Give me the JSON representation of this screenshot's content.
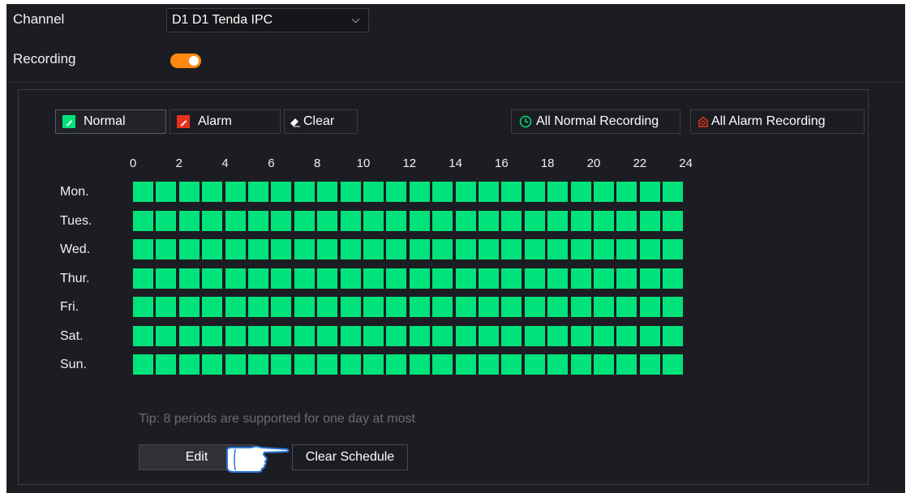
{
  "settings": {
    "channel_label": "Channel",
    "channel_value": "D1 D1 Tenda IPC",
    "recording_label": "Recording",
    "recording_enabled": true
  },
  "toolbar": {
    "normal_label": "Normal",
    "alarm_label": "Alarm",
    "clear_label": "Clear",
    "all_normal_label": "All Normal Recording",
    "all_alarm_label": "All Alarm Recording"
  },
  "schedule": {
    "hour_ticks": [
      "0",
      "2",
      "4",
      "6",
      "8",
      "10",
      "12",
      "14",
      "16",
      "18",
      "20",
      "22",
      "24"
    ],
    "days": [
      "Mon.",
      "Tues.",
      "Wed.",
      "Thur.",
      "Fri.",
      "Sat.",
      "Sun."
    ],
    "blocks_per_day": 24,
    "filled_hours": "all"
  },
  "tip": "Tip: 8 periods are supported for one day at most",
  "buttons": {
    "edit": "Edit",
    "clear_schedule": "Clear Schedule"
  },
  "colors": {
    "normal": "#00e37b",
    "alarm": "#e8311a",
    "toggle_on": "#ff8a0f"
  },
  "icons": [
    "normal-pen-icon",
    "alarm-pen-icon",
    "eraser-icon",
    "clock-icon",
    "alarm-clock-icon",
    "pointing-hand-icon",
    "chevron-down-icon"
  ]
}
